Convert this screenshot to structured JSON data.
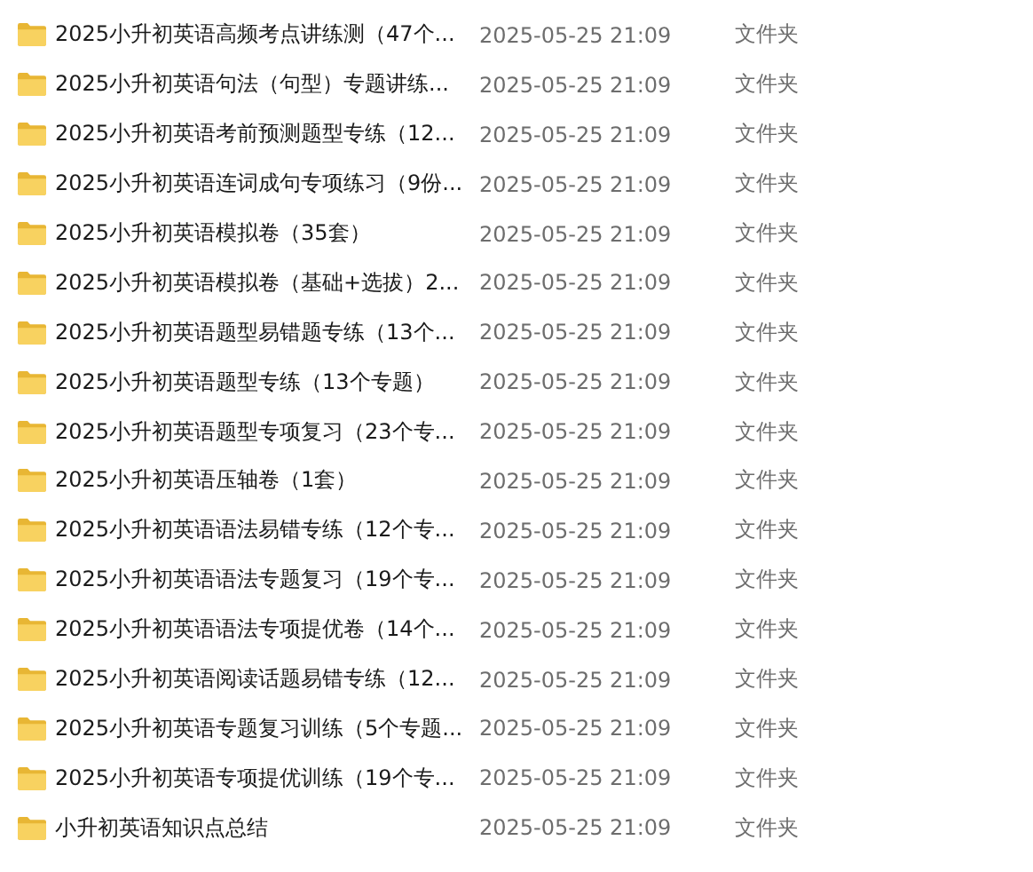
{
  "rows": [
    {
      "name": "2025小升初英语高频考点讲练测（47个...",
      "date": "2025-05-25 21:09",
      "type": "文件夹"
    },
    {
      "name": "2025小升初英语句法（句型）专题讲练...",
      "date": "2025-05-25 21:09",
      "type": "文件夹"
    },
    {
      "name": "2025小升初英语考前预测题型专练（12...",
      "date": "2025-05-25 21:09",
      "type": "文件夹"
    },
    {
      "name": "2025小升初英语连词成句专项练习（9份...",
      "date": "2025-05-25 21:09",
      "type": "文件夹"
    },
    {
      "name": "2025小升初英语模拟卷（35套）",
      "date": "2025-05-25 21:09",
      "type": "文件夹"
    },
    {
      "name": "2025小升初英语模拟卷（基础+选拔）2...",
      "date": "2025-05-25 21:09",
      "type": "文件夹"
    },
    {
      "name": "2025小升初英语题型易错题专练（13个...",
      "date": "2025-05-25 21:09",
      "type": "文件夹"
    },
    {
      "name": "2025小升初英语题型专练（13个专题）",
      "date": "2025-05-25 21:09",
      "type": "文件夹"
    },
    {
      "name": "2025小升初英语题型专项复习（23个专...",
      "date": "2025-05-25 21:09",
      "type": "文件夹"
    },
    {
      "name": "2025小升初英语压轴卷（1套）",
      "date": "2025-05-25 21:09",
      "type": "文件夹"
    },
    {
      "name": "2025小升初英语语法易错专练（12个专...",
      "date": "2025-05-25 21:09",
      "type": "文件夹"
    },
    {
      "name": "2025小升初英语语法专题复习（19个专...",
      "date": "2025-05-25 21:09",
      "type": "文件夹"
    },
    {
      "name": "2025小升初英语语法专项提优卷（14个...",
      "date": "2025-05-25 21:09",
      "type": "文件夹"
    },
    {
      "name": "2025小升初英语阅读话题易错专练（12...",
      "date": "2025-05-25 21:09",
      "type": "文件夹"
    },
    {
      "name": "2025小升初英语专题复习训练（5个专题...",
      "date": "2025-05-25 21:09",
      "type": "文件夹"
    },
    {
      "name": "2025小升初英语专项提优训练（19个专...",
      "date": "2025-05-25 21:09",
      "type": "文件夹"
    },
    {
      "name": "小升初英语知识点总结",
      "date": "2025-05-25 21:09",
      "type": "文件夹"
    }
  ]
}
